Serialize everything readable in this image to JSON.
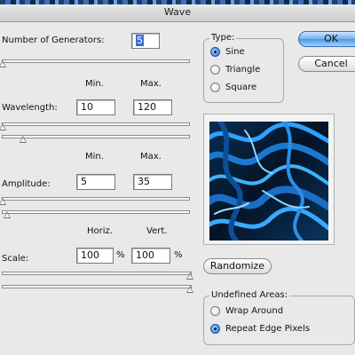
{
  "window": {
    "title": "Wave"
  },
  "generators": {
    "label": "Number of Generators:",
    "value": "5"
  },
  "columns": {
    "min": "Min.",
    "max": "Max."
  },
  "wavelength": {
    "label": "Wavelength:",
    "min": "10",
    "max": "120"
  },
  "amplitude": {
    "label": "Amplitude:",
    "min": "5",
    "max": "35"
  },
  "scale": {
    "label": "Scale:",
    "horiz_label": "Horiz.",
    "vert_label": "Vert.",
    "horiz": "100",
    "vert": "100",
    "unit": "%"
  },
  "type_group": {
    "legend": "Type:",
    "options": [
      "Sine",
      "Triangle",
      "Square"
    ],
    "selected": "Sine"
  },
  "buttons": {
    "ok": "OK",
    "cancel": "Cancel",
    "randomize": "Randomize"
  },
  "undefined_areas": {
    "legend": "Undefined Areas:",
    "options": [
      "Wrap Around",
      "Repeat Edge Pixels"
    ],
    "selected": "Repeat Edge Pixels"
  },
  "colors": {
    "accent": "#4e97e3",
    "preview_dark": "#031020",
    "preview_light": "#2fa0ff"
  }
}
